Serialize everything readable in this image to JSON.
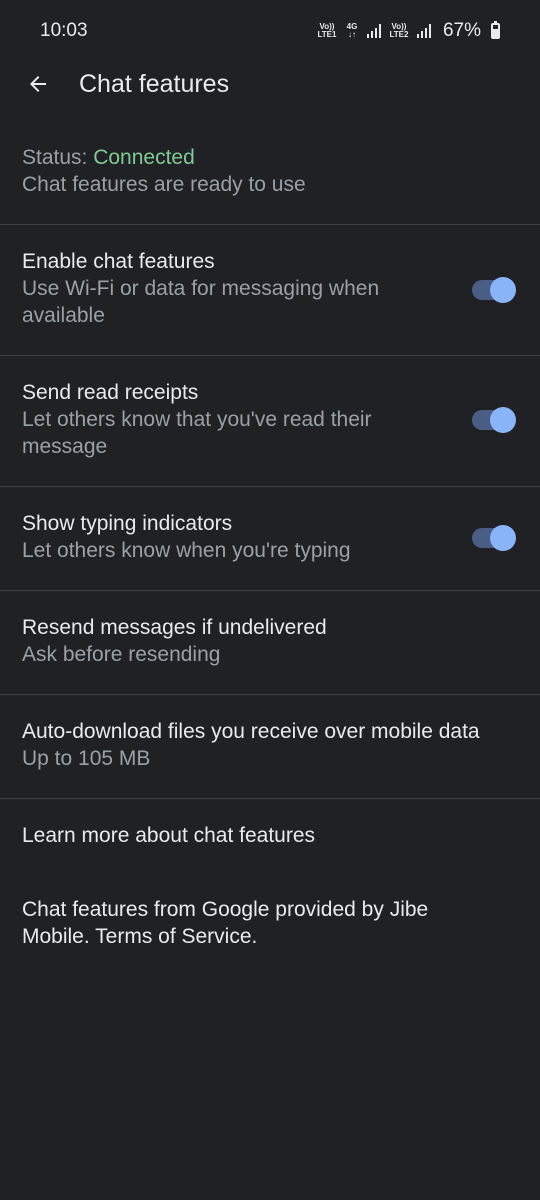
{
  "status_bar": {
    "time": "10:03",
    "sim1_label": "Vo)) LTE1",
    "network_type": "4G",
    "sim2_label": "Vo)) LTE2",
    "battery_percent": "67%"
  },
  "app_bar": {
    "title": "Chat features",
    "back_icon": "arrow-back-icon"
  },
  "status_block": {
    "label": "Status: ",
    "value": "Connected",
    "value_color": "#81c995",
    "description": "Chat features are ready to use"
  },
  "settings": [
    {
      "title": "Enable chat features",
      "subtitle": "Use Wi-Fi or data for messaging when available",
      "toggle_on": true
    },
    {
      "title": "Send read receipts",
      "subtitle": "Let others know that you've read their message",
      "toggle_on": true
    },
    {
      "title": "Show typing indicators",
      "subtitle": "Let others know when you're typing",
      "toggle_on": true
    },
    {
      "title": "Resend messages if undelivered",
      "subtitle": "Ask before resending"
    },
    {
      "title": "Auto-download files you receive over mobile data",
      "subtitle": "Up to 105 MB"
    }
  ],
  "learn_more": {
    "link_text": "Learn more",
    "rest_text": " about chat features"
  },
  "footer": {
    "text": "Chat features from Google provided by Jibe Mobile. Terms of Service."
  },
  "colors": {
    "background": "#202124",
    "accent": "#8ab4f8",
    "toggle_track": "#4a5d84",
    "secondary_text": "#9aa0a6"
  }
}
